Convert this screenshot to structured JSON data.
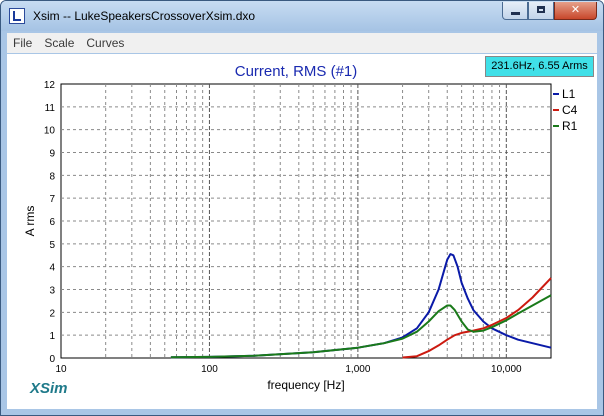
{
  "window": {
    "title": "Xsim -- LukeSpeakersCrossoverXsim.dxo",
    "controls": {
      "minimize_icon": "minimize-icon",
      "maximize_icon": "maximize-icon",
      "close_icon": "close-icon",
      "close_glyph": "✕"
    }
  },
  "menu": {
    "items": [
      "File",
      "Scale",
      "Curves"
    ]
  },
  "readout": "231.6Hz, 6.55 Arms",
  "brand": "XSim",
  "colors": {
    "L1": "#0a1aa8",
    "C4": "#cc1a10",
    "R1": "#1a7a1a",
    "title": "#1a2ab0",
    "readout_bg": "#40e0e8",
    "brand": "#1f7a8a"
  },
  "chart_data": {
    "type": "line",
    "title": "Current, RMS (#1)",
    "xlabel": "frequency [Hz]",
    "ylabel": "A rms",
    "x_scale": "log",
    "xlim": [
      10,
      20000
    ],
    "ylim": [
      0,
      12
    ],
    "grid": true,
    "legend_position": "right",
    "x_ticks": [
      10,
      100,
      1000,
      10000
    ],
    "x_tick_labels": [
      "10",
      "100",
      "1,000",
      "10,000"
    ],
    "y_ticks": [
      0,
      1,
      2,
      3,
      4,
      5,
      6,
      7,
      8,
      9,
      10,
      11,
      12
    ],
    "y_tick_labels": [
      "0",
      "1",
      "2",
      "3",
      "4",
      "5",
      "6",
      "7",
      "8",
      "9",
      "10",
      "11",
      "12"
    ],
    "series": [
      {
        "name": "L1",
        "x": [
          55,
          100,
          200,
          500,
          1000,
          1500,
          2000,
          2500,
          3000,
          3500,
          3800,
          4000,
          4200,
          4400,
          4700,
          5000,
          5500,
          6000,
          7000,
          8000,
          10000,
          12000,
          15000,
          20000
        ],
        "y": [
          0.03,
          0.05,
          0.1,
          0.25,
          0.45,
          0.65,
          0.9,
          1.3,
          2.0,
          3.0,
          3.8,
          4.3,
          4.55,
          4.5,
          4.0,
          3.3,
          2.6,
          2.1,
          1.6,
          1.3,
          1.0,
          0.8,
          0.65,
          0.45
        ]
      },
      {
        "name": "C4",
        "x": [
          2000,
          2500,
          3000,
          3500,
          4000,
          4500,
          5000,
          6000,
          7000,
          8000,
          10000,
          12000,
          15000,
          20000
        ],
        "y": [
          0.02,
          0.08,
          0.3,
          0.55,
          0.8,
          1.0,
          1.1,
          1.2,
          1.3,
          1.45,
          1.75,
          2.1,
          2.65,
          3.5
        ]
      },
      {
        "name": "R1",
        "x": [
          55,
          100,
          200,
          500,
          1000,
          1500,
          2000,
          2500,
          3000,
          3500,
          4000,
          4200,
          4500,
          5000,
          5500,
          6000,
          7000,
          8000,
          10000,
          12000,
          15000,
          20000
        ],
        "y": [
          0.03,
          0.05,
          0.1,
          0.25,
          0.45,
          0.65,
          0.85,
          1.15,
          1.6,
          2.05,
          2.3,
          2.3,
          2.1,
          1.6,
          1.25,
          1.15,
          1.2,
          1.35,
          1.65,
          1.95,
          2.3,
          2.75
        ]
      }
    ]
  }
}
